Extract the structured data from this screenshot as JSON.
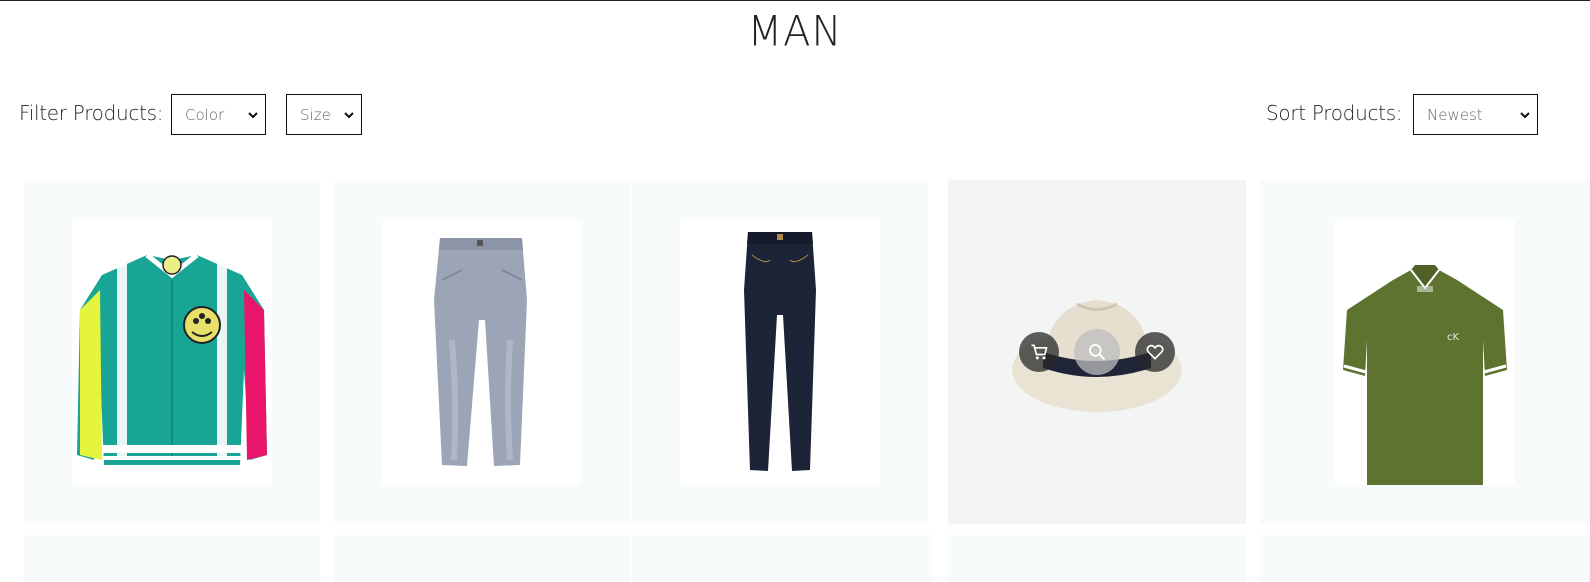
{
  "page": {
    "title": "MAN"
  },
  "filters": {
    "label": "Filter Products:",
    "color": {
      "selected": "Color"
    },
    "size": {
      "selected": "Size"
    }
  },
  "sort": {
    "label": "Sort Products:",
    "selected": "Newest"
  },
  "products": [
    {
      "icon": "varsity-jacket-image",
      "color": "#1aa89a"
    },
    {
      "icon": "light-wash-jeans-image",
      "color": "#9aa3b3"
    },
    {
      "icon": "dark-jeans-image",
      "color": "#1e2436"
    },
    {
      "icon": "straw-fedora-hat-image",
      "color": "#e6dfcf",
      "hovered": true
    },
    {
      "icon": "green-polo-shirt-image",
      "color": "#5f7330"
    }
  ],
  "product_actions": [
    "cart-icon",
    "search-icon",
    "heart-icon"
  ]
}
